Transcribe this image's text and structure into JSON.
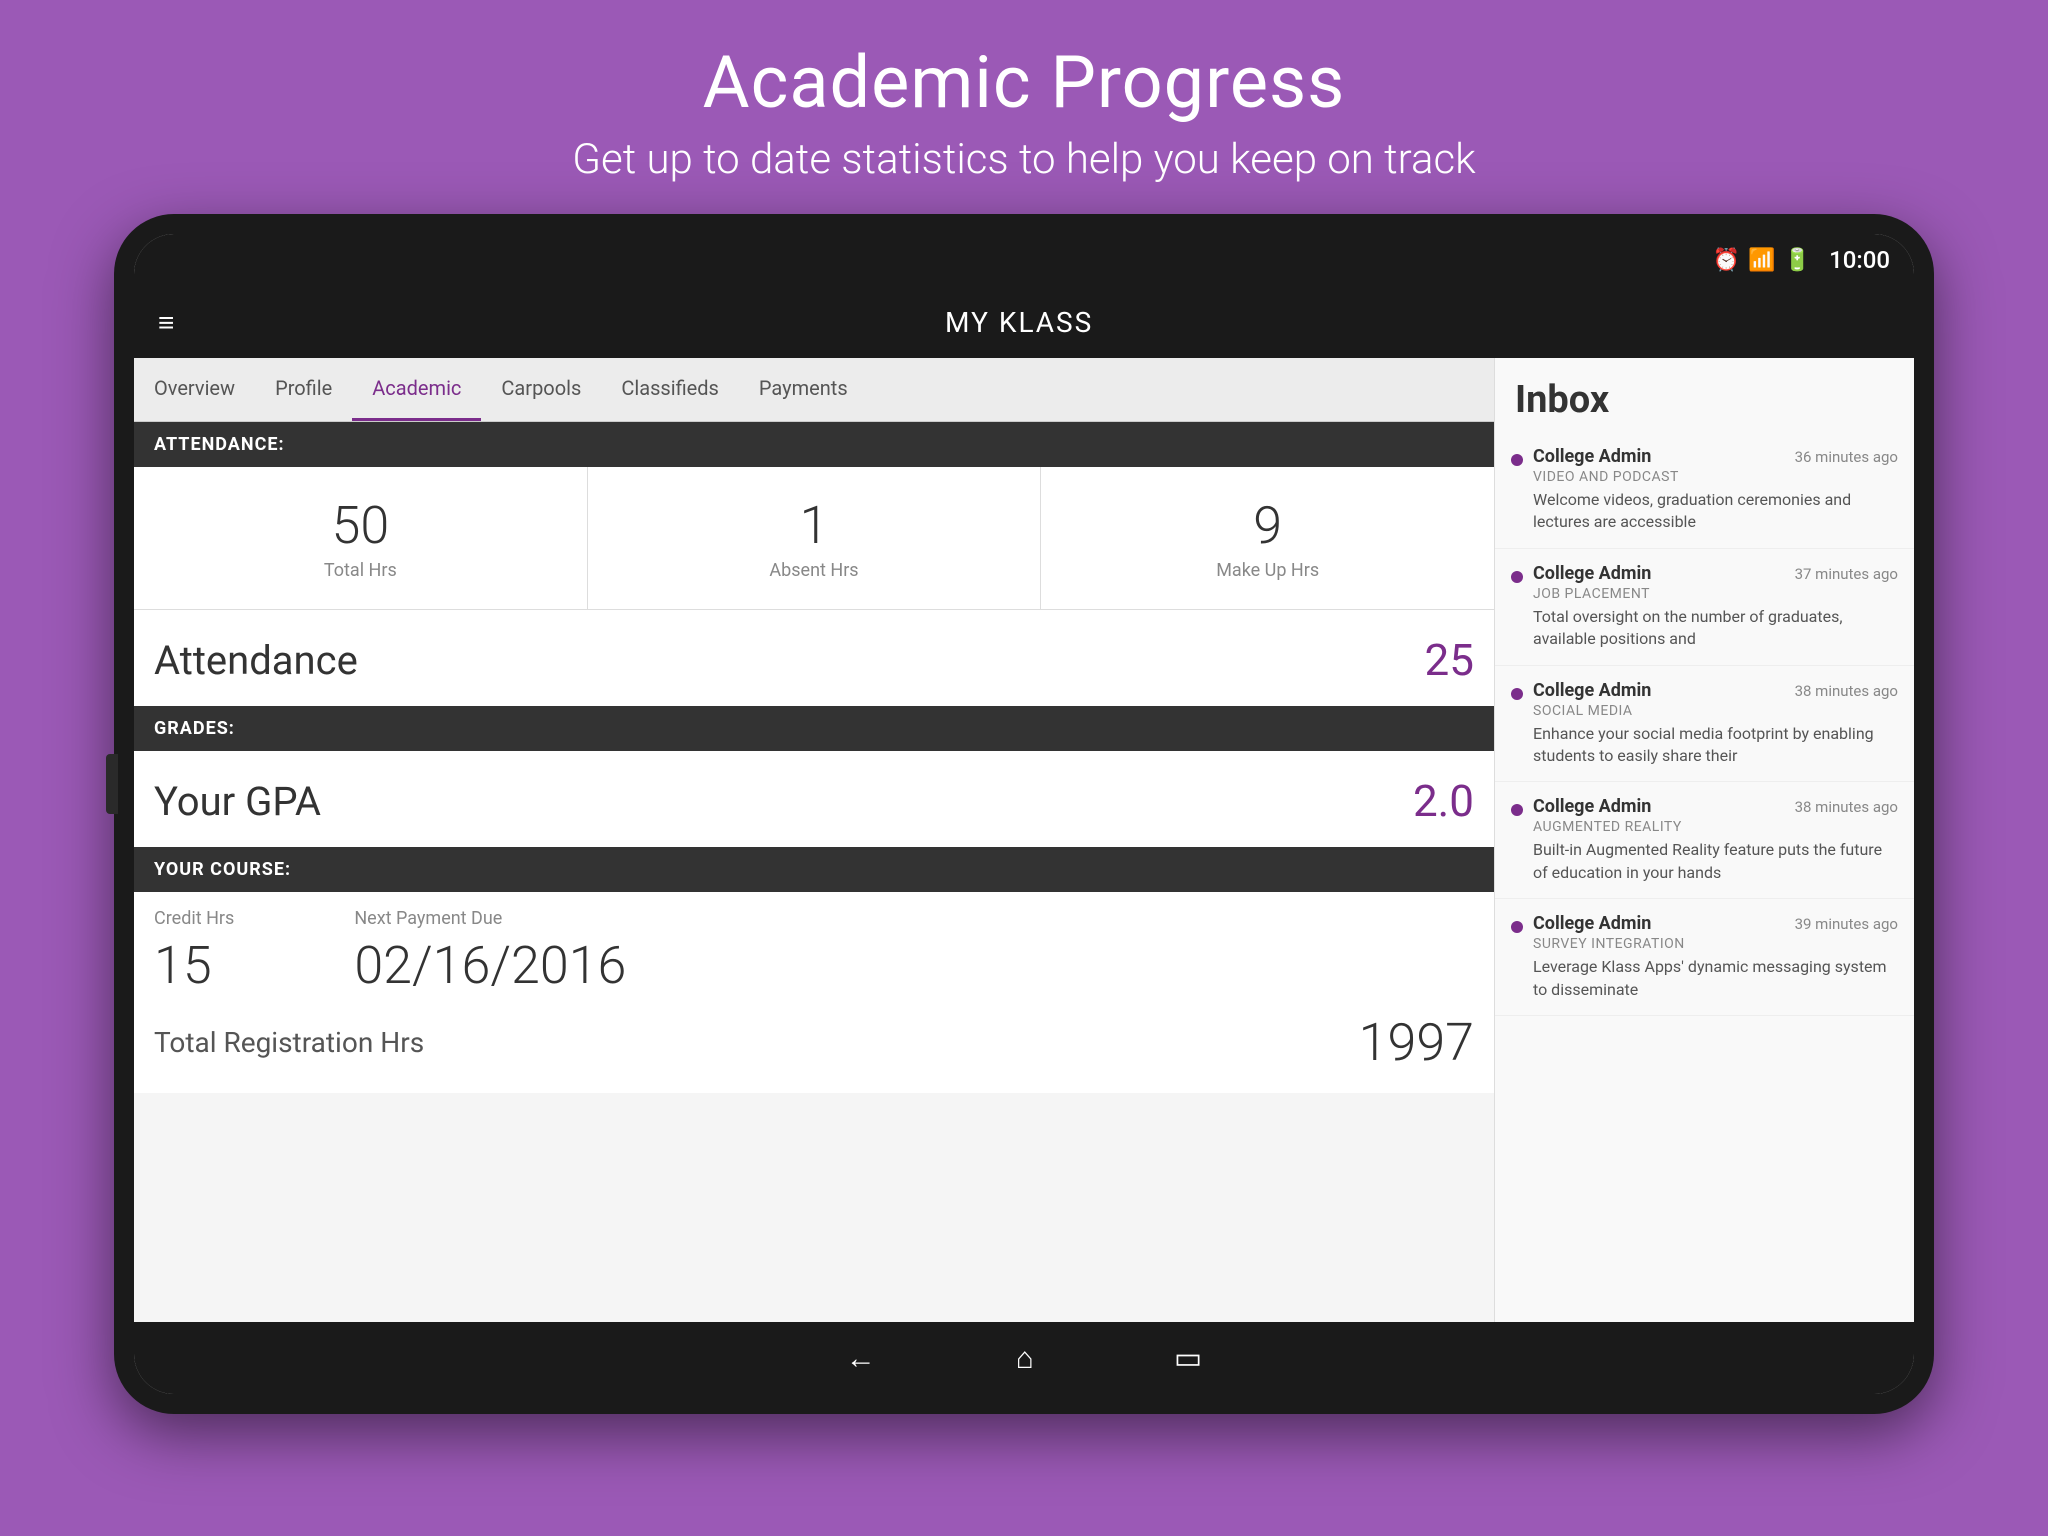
{
  "page": {
    "title": "Academic Progress",
    "subtitle": "Get up to date statistics to help you keep on track"
  },
  "statusBar": {
    "time": "10:00"
  },
  "appBar": {
    "title": "MY KLASS",
    "hamburger": "≡"
  },
  "tabs": [
    {
      "label": "Overview",
      "active": false
    },
    {
      "label": "Profile",
      "active": false
    },
    {
      "label": "Academic",
      "active": true
    },
    {
      "label": "Carpools",
      "active": false
    },
    {
      "label": "Classifieds",
      "active": false
    },
    {
      "label": "Payments",
      "active": false
    }
  ],
  "attendance": {
    "sectionLabel": "ATTENDANCE:",
    "stats": [
      {
        "value": "50",
        "label": "Total Hrs"
      },
      {
        "value": "1",
        "label": "Absent Hrs"
      },
      {
        "value": "9",
        "label": "Make Up Hrs"
      }
    ],
    "metricLabel": "Attendance",
    "metricValue": "25"
  },
  "grades": {
    "sectionLabel": "GRADES:",
    "metricLabel": "Your GPA",
    "metricValue": "2.0"
  },
  "course": {
    "sectionLabel": "YOUR COURSE:",
    "creditHrsLabel": "Credit Hrs",
    "creditHrsValue": "15",
    "paymentDueLabel": "Next Payment Due",
    "paymentDueValue": "02/16/2016",
    "overflowLabel": "Total Registration Hrs",
    "overflowValue": "1997"
  },
  "inbox": {
    "title": "Inbox",
    "items": [
      {
        "sender": "College Admin",
        "time": "36 minutes ago",
        "category": "VIDEO AND PODCAST",
        "preview": "Welcome videos, graduation ceremonies and lectures are accessible"
      },
      {
        "sender": "College Admin",
        "time": "37 minutes ago",
        "category": "JOB PLACEMENT",
        "preview": "Total oversight on the number of graduates, available positions and"
      },
      {
        "sender": "College Admin",
        "time": "38 minutes ago",
        "category": "SOCIAL MEDIA",
        "preview": "Enhance your social media footprint by enabling students to easily share their"
      },
      {
        "sender": "College Admin",
        "time": "38 minutes ago",
        "category": "AUGMENTED REALITY",
        "preview": "Built-in Augmented Reality feature puts the future of education in your hands"
      },
      {
        "sender": "College Admin",
        "time": "39 minutes ago",
        "category": "SURVEY INTEGRATION",
        "preview": "Leverage Klass Apps' dynamic messaging system to disseminate"
      }
    ]
  },
  "bottomNav": {
    "back": "←",
    "home": "⌂",
    "recent": "▭"
  }
}
